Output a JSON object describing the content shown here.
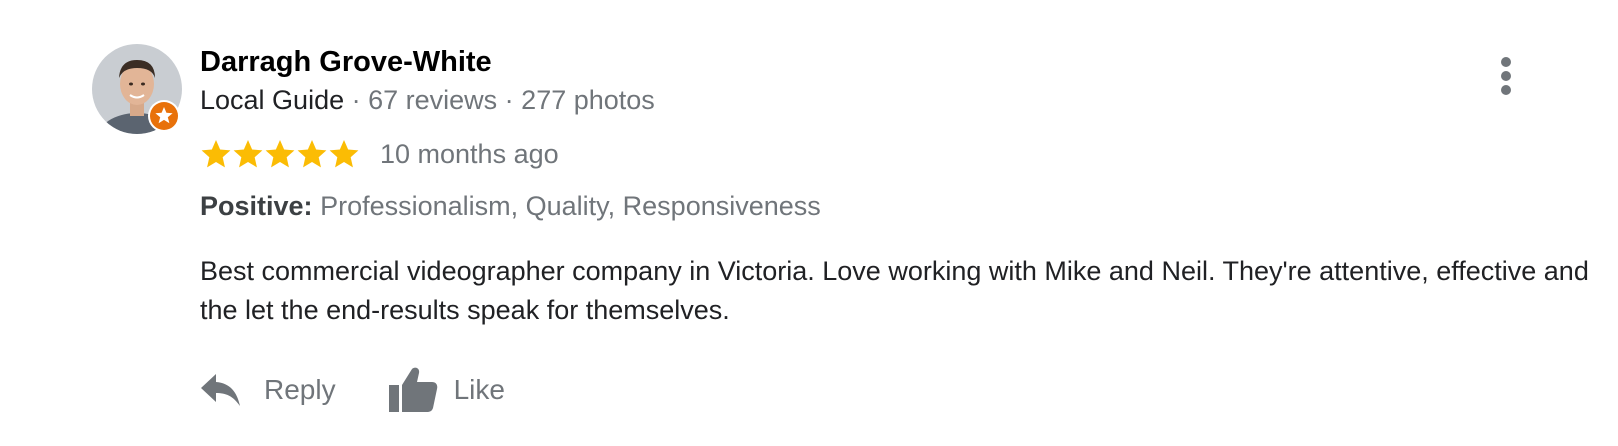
{
  "reviewer": {
    "name": "Darragh Grove-White",
    "badge": "Local Guide",
    "separator": " · ",
    "reviews": "67 reviews",
    "photos": "277 photos"
  },
  "rating": {
    "stars": 5,
    "max": 5,
    "star_color": "#fbbc04"
  },
  "time": "10 months ago",
  "tags": {
    "label": "Positive:",
    "values": "Professionalism, Quality, Responsiveness"
  },
  "text": "Best commercial videographer company in Victoria. Love working with Mike and Neil. They're attentive, effective and the let the end-results speak for themselves.",
  "actions": {
    "reply_label": "Reply",
    "like_label": "Like"
  },
  "icons": {
    "menu": "more-vert-icon",
    "reply": "reply-icon",
    "like": "thumbs-up-icon",
    "badge": "local-guide-badge-icon"
  },
  "colors": {
    "secondary_text": "#70757a",
    "badge_orange": "#e8710a"
  }
}
